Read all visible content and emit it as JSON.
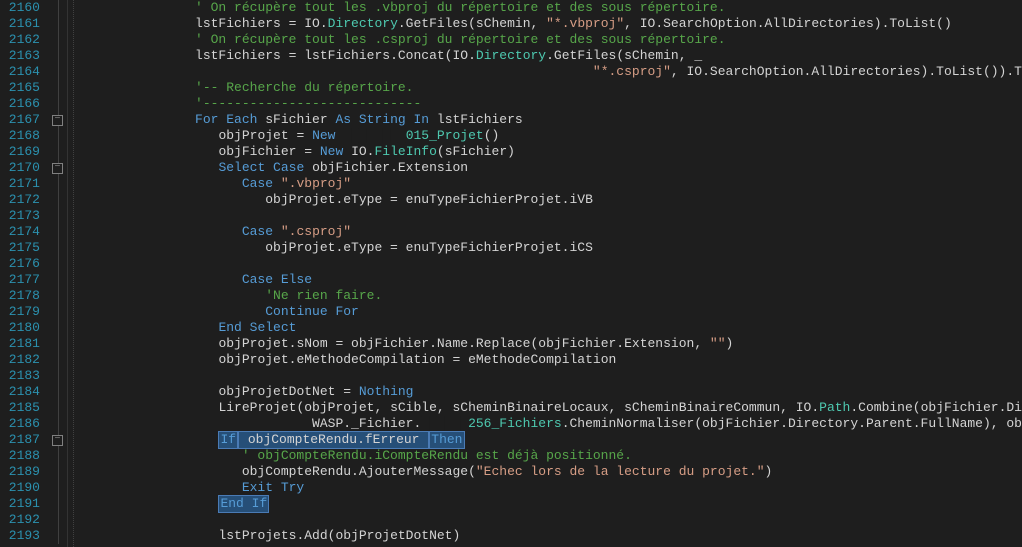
{
  "first_line": 2160,
  "lines": [
    {
      "n": 2160,
      "fold": "",
      "indent": "               ",
      "tokens": [
        {
          "t": "' On récupère tout les .vbproj du répertoire et des sous répertoire.",
          "c": "cm"
        }
      ]
    },
    {
      "n": 2161,
      "fold": "",
      "indent": "               ",
      "tokens": [
        {
          "t": "lstFichiers = IO.",
          "c": "id"
        },
        {
          "t": "Directory",
          "c": "tp"
        },
        {
          "t": ".GetFiles(sChemin, ",
          "c": "id"
        },
        {
          "t": "\"*.vbproj\"",
          "c": "st"
        },
        {
          "t": ", IO.SearchOption.AllDirectories).ToList()",
          "c": "id"
        }
      ]
    },
    {
      "n": 2162,
      "fold": "",
      "indent": "               ",
      "tokens": [
        {
          "t": "' On récupère tout les .csproj du répertoire et des sous répertoire.",
          "c": "cm"
        }
      ]
    },
    {
      "n": 2163,
      "fold": "",
      "indent": "               ",
      "tokens": [
        {
          "t": "lstFichiers = lstFichiers.Concat(IO.",
          "c": "id"
        },
        {
          "t": "Directory",
          "c": "tp"
        },
        {
          "t": ".GetFiles(sChemin, _",
          "c": "id"
        }
      ]
    },
    {
      "n": 2164,
      "fold": "",
      "indent": "                                                                  ",
      "tokens": [
        {
          "t": "\"*.csproj\"",
          "c": "st"
        },
        {
          "t": ", IO.SearchOption.AllDirectories).ToList()).ToList()",
          "c": "id"
        }
      ]
    },
    {
      "n": 2165,
      "fold": "",
      "indent": "               ",
      "tokens": [
        {
          "t": "'-- Recherche du répertoire.",
          "c": "cm"
        }
      ]
    },
    {
      "n": 2166,
      "fold": "",
      "indent": "               ",
      "tokens": [
        {
          "t": "'----------------------------",
          "c": "cm"
        }
      ]
    },
    {
      "n": 2167,
      "fold": "box",
      "indent": "               ",
      "tokens": [
        {
          "t": "For Each",
          "c": "kw"
        },
        {
          "t": " sFichier ",
          "c": "id"
        },
        {
          "t": "As String In",
          "c": "kw"
        },
        {
          "t": " lstFichiers",
          "c": "id"
        }
      ]
    },
    {
      "n": 2168,
      "fold": "",
      "indent": "                  ",
      "tokens": [
        {
          "t": "objProjet = ",
          "c": "id"
        },
        {
          "t": "New",
          "c": "kw"
        },
        {
          "t": " ",
          "c": "id"
        },
        {
          "t": "████████",
          "c": "redact"
        },
        {
          "t": "015_Projet",
          "c": "tp"
        },
        {
          "t": "()",
          "c": "id"
        }
      ]
    },
    {
      "n": 2169,
      "fold": "",
      "indent": "                  ",
      "tokens": [
        {
          "t": "objFichier = ",
          "c": "id"
        },
        {
          "t": "New",
          "c": "kw"
        },
        {
          "t": " IO.",
          "c": "id"
        },
        {
          "t": "FileInfo",
          "c": "tp"
        },
        {
          "t": "(sFichier)",
          "c": "id"
        }
      ]
    },
    {
      "n": 2170,
      "fold": "box",
      "indent": "                  ",
      "tokens": [
        {
          "t": "Select Case",
          "c": "kw"
        },
        {
          "t": " objFichier.Extension",
          "c": "id"
        }
      ]
    },
    {
      "n": 2171,
      "fold": "",
      "indent": "                     ",
      "tokens": [
        {
          "t": "Case",
          "c": "kw"
        },
        {
          "t": " ",
          "c": "id"
        },
        {
          "t": "\".vbproj\"",
          "c": "st"
        }
      ]
    },
    {
      "n": 2172,
      "fold": "",
      "indent": "                        ",
      "tokens": [
        {
          "t": "objProjet.eType = enuTypeFichierProjet.iVB",
          "c": "id"
        }
      ]
    },
    {
      "n": 2173,
      "fold": "",
      "indent": "",
      "tokens": []
    },
    {
      "n": 2174,
      "fold": "",
      "indent": "                     ",
      "tokens": [
        {
          "t": "Case",
          "c": "kw"
        },
        {
          "t": " ",
          "c": "id"
        },
        {
          "t": "\".csproj\"",
          "c": "st"
        }
      ]
    },
    {
      "n": 2175,
      "fold": "",
      "indent": "                        ",
      "tokens": [
        {
          "t": "objProjet.eType = enuTypeFichierProjet.iCS",
          "c": "id"
        }
      ]
    },
    {
      "n": 2176,
      "fold": "",
      "indent": "",
      "tokens": []
    },
    {
      "n": 2177,
      "fold": "",
      "indent": "                     ",
      "tokens": [
        {
          "t": "Case Else",
          "c": "kw"
        }
      ]
    },
    {
      "n": 2178,
      "fold": "",
      "indent": "                        ",
      "tokens": [
        {
          "t": "'Ne rien faire.",
          "c": "cm"
        }
      ]
    },
    {
      "n": 2179,
      "fold": "",
      "indent": "                        ",
      "tokens": [
        {
          "t": "Continue For",
          "c": "kw"
        }
      ]
    },
    {
      "n": 2180,
      "fold": "",
      "indent": "                  ",
      "tokens": [
        {
          "t": "End Select",
          "c": "kw"
        }
      ]
    },
    {
      "n": 2181,
      "fold": "",
      "indent": "                  ",
      "tokens": [
        {
          "t": "objProjet.sNom = objFichier.Name.Replace(objFichier.Extension, ",
          "c": "id"
        },
        {
          "t": "\"\"",
          "c": "st"
        },
        {
          "t": ")",
          "c": "id"
        }
      ]
    },
    {
      "n": 2182,
      "fold": "",
      "indent": "                  ",
      "tokens": [
        {
          "t": "objProjet.eMethodeCompilation = eMethodeCompilation",
          "c": "id"
        }
      ]
    },
    {
      "n": 2183,
      "fold": "",
      "indent": "",
      "tokens": []
    },
    {
      "n": 2184,
      "fold": "",
      "indent": "                  ",
      "tokens": [
        {
          "t": "objProjetDotNet = ",
          "c": "id"
        },
        {
          "t": "Nothing",
          "c": "kw"
        }
      ]
    },
    {
      "n": 2185,
      "fold": "",
      "indent": "                  ",
      "tokens": [
        {
          "t": "LireProjet(objProjet, sCible, sCheminBinaireLocaux, sCheminBinaireCommun, IO.",
          "c": "id"
        },
        {
          "t": "Path",
          "c": "tp"
        },
        {
          "t": ".Combine(objFichier.DirectoryName, ",
          "c": "id"
        },
        {
          "t": "\"",
          "c": "st"
        }
      ]
    },
    {
      "n": 2186,
      "fold": "",
      "indent": "                              ",
      "tokens": [
        {
          "t": "WASP._Fichier.",
          "c": "id"
        },
        {
          "t": "██████",
          "c": "redact"
        },
        {
          "t": "256_Fichiers",
          "c": "tp"
        },
        {
          "t": ".CheminNormaliser(objFichier.Directory.Parent.FullName), objProjetDotNet,",
          "c": "id"
        }
      ]
    },
    {
      "n": 2187,
      "fold": "box",
      "indent": "                  ",
      "tokens": [
        {
          "t": "If",
          "c": "kw",
          "sel": true
        },
        {
          "t": " objCompteRendu.fErreur ",
          "c": "id",
          "sel": true
        },
        {
          "t": "Then",
          "c": "kw",
          "sel": true
        }
      ]
    },
    {
      "n": 2188,
      "fold": "",
      "indent": "                     ",
      "tokens": [
        {
          "t": "' objCompteRendu.iCompteRendu est déjà positionné.",
          "c": "cm"
        }
      ]
    },
    {
      "n": 2189,
      "fold": "",
      "indent": "                     ",
      "tokens": [
        {
          "t": "objCompteRendu.AjouterMessage(",
          "c": "id"
        },
        {
          "t": "\"Echec lors de la lecture du projet.\"",
          "c": "st"
        },
        {
          "t": ")",
          "c": "id"
        }
      ]
    },
    {
      "n": 2190,
      "fold": "",
      "indent": "                     ",
      "tokens": [
        {
          "t": "Exit Try",
          "c": "kw"
        }
      ]
    },
    {
      "n": 2191,
      "fold": "",
      "indent": "                  ",
      "tokens": [
        {
          "t": "End If",
          "c": "kw",
          "sel": true
        }
      ]
    },
    {
      "n": 2192,
      "fold": "",
      "indent": "",
      "tokens": []
    },
    {
      "n": 2193,
      "fold": "",
      "indent": "                  ",
      "tokens": [
        {
          "t": "lstProjets.Add(objProjetDotNet)",
          "c": "id"
        }
      ]
    }
  ]
}
